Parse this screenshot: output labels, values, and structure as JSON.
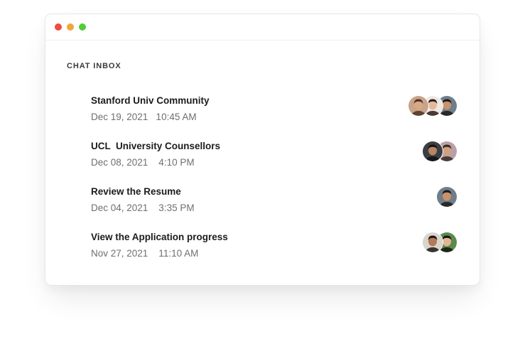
{
  "window": {
    "controls": [
      "close",
      "minimize",
      "maximize"
    ],
    "colors": {
      "close": "#ef4b3f",
      "minimize": "#f2a53a",
      "maximize": "#4fcd3a"
    }
  },
  "inbox": {
    "title": "CHAT INBOX",
    "chats": [
      {
        "name": "Stanford Univ Community",
        "time": "Dec 19, 2021   10:45 AM",
        "avatars": [
          {
            "icon": "person-avatar-icon",
            "bg": "#c9a48a",
            "skin": "#d9a884",
            "hair": "#4a3326"
          },
          {
            "icon": "person-avatar-icon",
            "bg": "#efe8e2",
            "skin": "#e3b99a",
            "hair": "#2a1c16"
          },
          {
            "icon": "person-avatar-icon",
            "bg": "#6f7e8a",
            "skin": "#c8926b",
            "hair": "#1e1a18"
          }
        ]
      },
      {
        "name": "UCL  University Counsellors",
        "time": "Dec 08, 2021    4:10 PM",
        "avatars": [
          {
            "icon": "person-avatar-icon",
            "bg": "#3b3f44",
            "skin": "#b98563",
            "hair": "#141211"
          },
          {
            "icon": "person-avatar-icon",
            "bg": "#b9a0a8",
            "skin": "#d1a07e",
            "hair": "#3a2a22"
          }
        ]
      },
      {
        "name": "Review the Resume",
        "time": "Dec 04, 2021    3:35 PM",
        "avatars": [
          {
            "icon": "person-avatar-icon",
            "bg": "#6f7e8a",
            "skin": "#c8926b",
            "hair": "#1e1a18"
          }
        ]
      },
      {
        "name": "View the Application progress",
        "time": "Nov 27, 2021    11:10 AM",
        "avatars": [
          {
            "icon": "person-avatar-icon",
            "bg": "#d9d4ce",
            "skin": "#b27a57",
            "hair": "#1a1715"
          },
          {
            "icon": "person-avatar-icon",
            "bg": "#5c8a4a",
            "skin": "#e0b596",
            "hair": "#151312"
          }
        ]
      }
    ]
  }
}
